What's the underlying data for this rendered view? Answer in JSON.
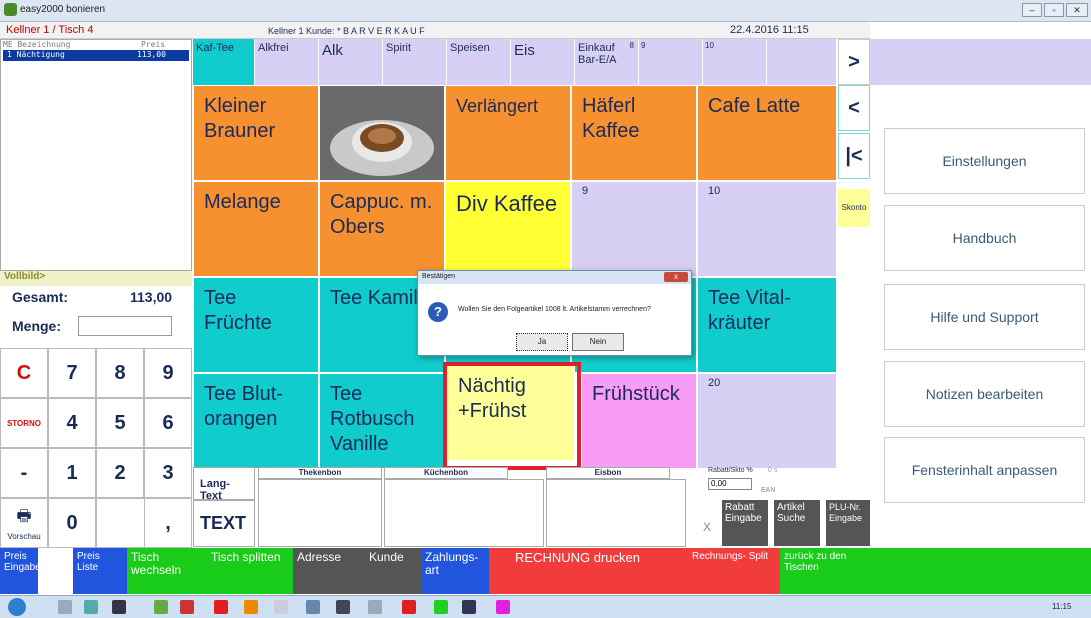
{
  "window": {
    "title": "easy2000 bonieren"
  },
  "header": {
    "kellner_tisch": "Kellner  1  / Tisch  4",
    "kellner_kunde": "Kellner 1  Kunde: * B A R V E R K A U F",
    "datetime": "22.4.2016 11:15"
  },
  "list": {
    "header_me": "ME Bezeichnung",
    "header_preis": "Preis",
    "row_name": "1 Nächtigung",
    "row_price": "113,00"
  },
  "summary": {
    "vollbild": "Vollbild>",
    "gesamt_label": "Gesamt:",
    "gesamt_value": "113,00",
    "menge_label": "Menge:"
  },
  "keypad": {
    "c": "C",
    "k7": "7",
    "k8": "8",
    "k9": "9",
    "storno": "STORNO",
    "k4": "4",
    "k5": "5",
    "k6": "6",
    "minus": "-",
    "k1": "1",
    "k2": "2",
    "k3": "3",
    "vorschau": "Vorschau",
    "k0": "0",
    "comma": ","
  },
  "categories": {
    "c1": "Kaf-Tee",
    "c2": "Alkfrei",
    "c3": "Alk",
    "c4": "Spirit",
    "c5": "Speisen",
    "c6": "Eis",
    "c7a": "Einkauf",
    "c7b": "Bar-E/A",
    "n8": "8",
    "n9": "9",
    "n10": "10"
  },
  "nav": {
    "next": ">",
    "prev": "<",
    "first": "|<",
    "skonto": "Skonto"
  },
  "tiles": {
    "t1": "Kleiner Brauner",
    "t3": "Verlängert",
    "t4": "Häferl Kaffee",
    "t5": "Cafe Latte",
    "t6": "Melange",
    "t7": "Cappuc. m. Obers",
    "t8": "Div Kaffee",
    "t9": "9",
    "t10": "10",
    "t11": "Tee Früchte",
    "t12": "Tee Kamille",
    "t15": "Tee Vital- kräuter",
    "t16": "Tee Blut- orangen",
    "t17": "Tee Rotbusch Vanille",
    "t18": "Nächtig +Frühst",
    "t19": "Frühstück",
    "t20": "20"
  },
  "right": {
    "einstellungen": "Einstellungen",
    "handbuch": "Handbuch",
    "hilfe": "Hilfe und Support",
    "notizen": "Notizen bearbeiten",
    "fenster": "Fensterinhalt anpassen"
  },
  "lower": {
    "langtext": "Lang-Text",
    "text": "TEXT",
    "thekenbon": "Thekenbon",
    "kuechenbon": "Küchenbon",
    "eisbon": "Eisbon",
    "rabatt_label": "Rabatt/Skto %",
    "rabatt_suffix": "0 s",
    "rabatt_value": "0,00",
    "ean": "EAN",
    "x": "X",
    "rabatt_eingabe": "Rabatt Eingabe",
    "artikel_suche": "Artikel Suche",
    "plu_eingabe": "PLU-Nr. Eingabe"
  },
  "bottom": {
    "preis_eingabe": "Preis Eingabe",
    "preis_liste": "Preis Liste",
    "tisch_wechseln": "Tisch wechseln",
    "tisch_splitten": "Tisch splitten",
    "adresse": "Adresse",
    "kunde": "Kunde",
    "zahlungsart": "Zahlungs- art",
    "rechnung": "RECHNUNG drucken",
    "rechnungs_split": "Rechnungs- Split",
    "zurueck": "zurück zu den Tischen"
  },
  "dialog": {
    "title": "Bestätigen",
    "message": "Wollen Sie den Folgeartikel 1008 lt. Artikelstamm verrechnen?",
    "ja": "Ja",
    "nein": "Nein",
    "close": "x"
  },
  "taskbar": {
    "time": "11:15"
  },
  "colors": {
    "orange": "#f7902f",
    "cyan": "#10cccc",
    "yellow": "#ffff33",
    "lavender": "#d8d0f4",
    "pink": "#f99cf5",
    "green": "#19cc19",
    "red": "#f23b3b",
    "gray": "#555555",
    "blue": "#2255dd",
    "highlight": "#e0202a"
  }
}
